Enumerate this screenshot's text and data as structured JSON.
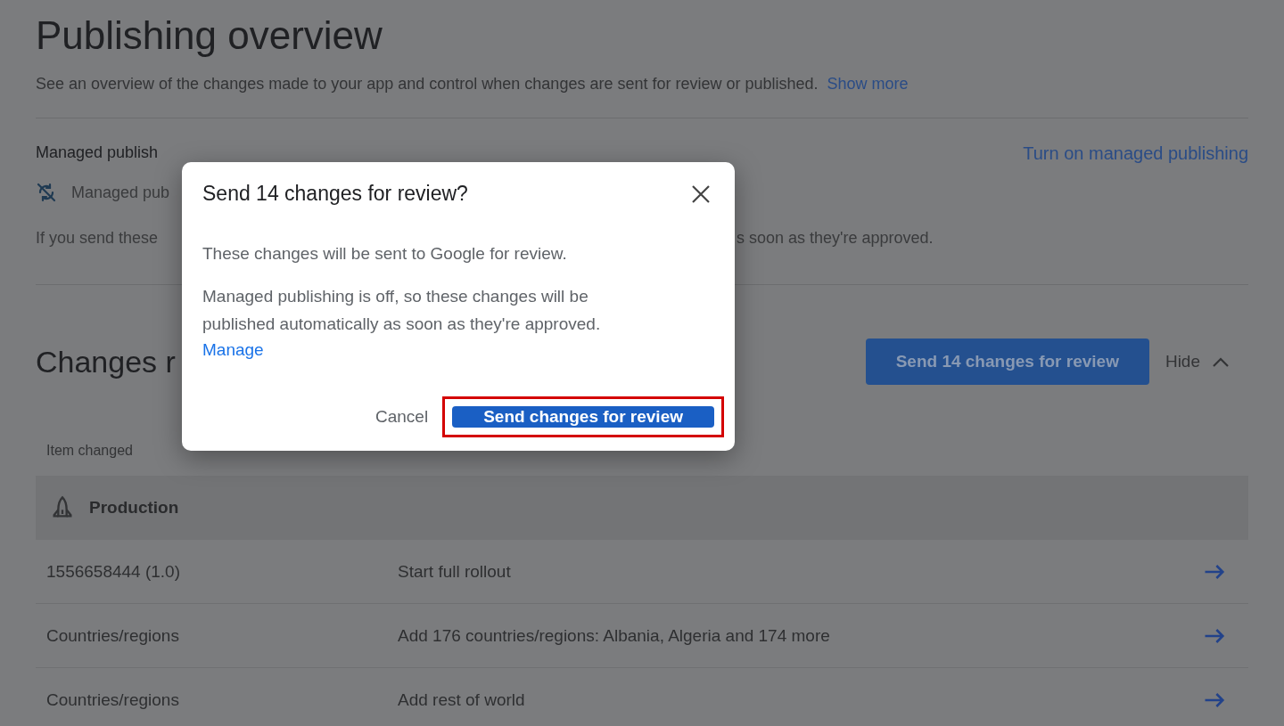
{
  "page": {
    "title": "Publishing overview",
    "subtitle": "See an overview of the changes made to your app and control when changes are sent for review or published.",
    "subtitle_link": "Show more"
  },
  "managed_publishing": {
    "heading": "Managed publish",
    "action": "Turn on managed publishing",
    "status": "Managed pub",
    "note_start": "If you send these",
    "note_end": "s soon as they're approved."
  },
  "changes": {
    "heading": "Changes r",
    "send_button": "Send 14 changes for review",
    "toggle": "Hide",
    "expanded": true,
    "column_1": "Item changed",
    "groups": [
      {
        "name": "Production",
        "rows": [
          {
            "item": "1556658444 (1.0)",
            "change": "Start full rollout"
          },
          {
            "item": "Countries/regions",
            "change": "Add 176 countries/regions: Albania, Algeria and 174 more"
          },
          {
            "item": "Countries/regions",
            "change": "Add rest of world"
          }
        ]
      }
    ]
  },
  "dialog": {
    "title": "Send 14 changes for review?",
    "paragraphs": [
      "These changes will be sent to Google for review.",
      "Managed publishing is off, so these changes will be published automatically as soon as they're approved."
    ],
    "link": "Manage",
    "buttons": [
      {
        "label": "Cancel",
        "kind": "text"
      },
      {
        "label": "Send changes for review",
        "kind": "primary",
        "highlighted": true
      }
    ]
  }
}
